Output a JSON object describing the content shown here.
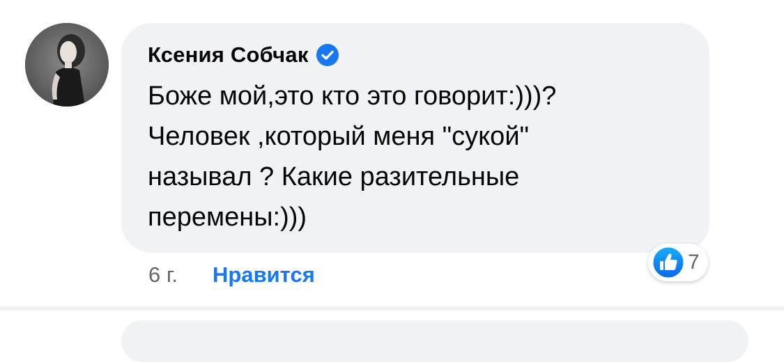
{
  "comment": {
    "author": "Ксения Собчак",
    "verified": true,
    "text": "Боже мой,это кто это говорит:)))?\nЧеловек ,который меня \"сукой\"\nназывал ? Какие разительные\nперемены:)))",
    "timestamp": "6 г.",
    "like_label": "Нравится",
    "reactions": {
      "icon": "thumbs-up-icon",
      "count": "7"
    }
  },
  "colors": {
    "bubble_bg": "#f0f2f5",
    "accent": "#1877f2",
    "secondary_text": "#65676b",
    "primary_text": "#050505"
  }
}
